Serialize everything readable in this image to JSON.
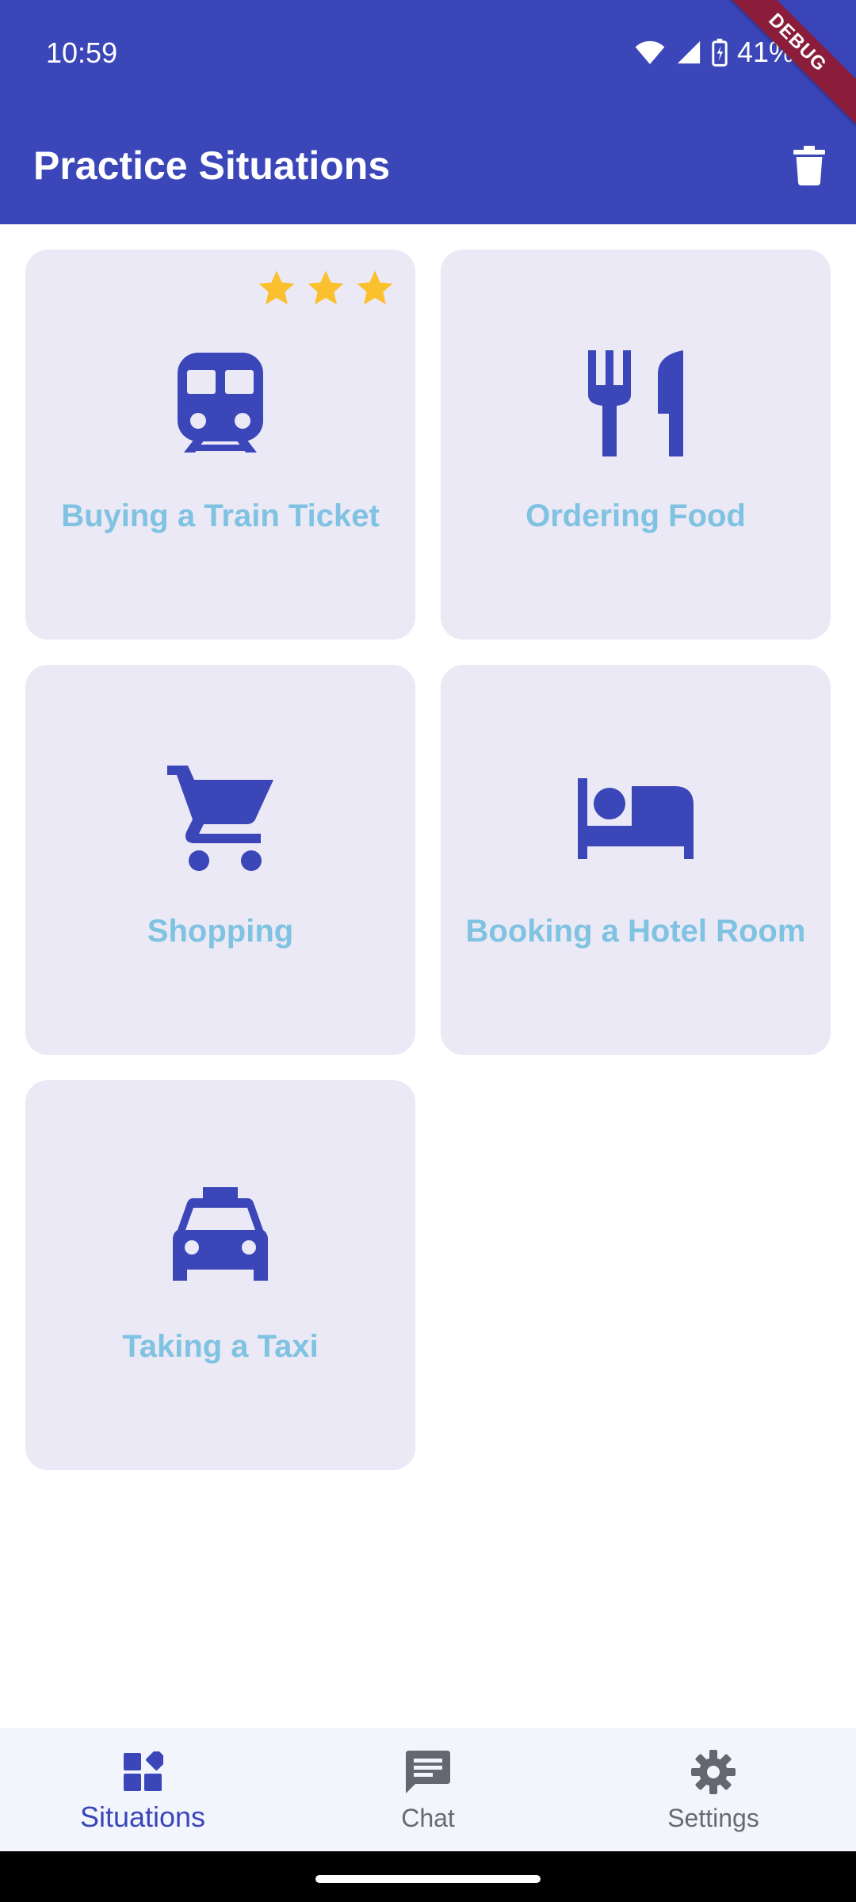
{
  "status_bar": {
    "time": "10:59",
    "battery": "41%"
  },
  "debug_banner": "DEBUG",
  "app_bar": {
    "title": "Practice Situations",
    "action_icon": "trash-icon"
  },
  "colors": {
    "primary": "#3b46b9",
    "card_background": "#eae9f5",
    "card_label": "#7fc2e2",
    "star": "#fbc02d",
    "nav_background": "#f3f5fd"
  },
  "situations": [
    {
      "label": "Buying a Train Ticket",
      "icon": "train-icon",
      "stars": 3
    },
    {
      "label": "Ordering Food",
      "icon": "restaurant-icon",
      "stars": 0
    },
    {
      "label": "Shopping",
      "icon": "shopping-cart-icon",
      "stars": 0
    },
    {
      "label": "Booking a Hotel Room",
      "icon": "bed-icon",
      "stars": 0
    },
    {
      "label": "Taking a Taxi",
      "icon": "taxi-icon",
      "stars": 0
    }
  ],
  "bottom_nav": {
    "items": [
      {
        "label": "Situations",
        "icon": "widgets-icon",
        "active": true
      },
      {
        "label": "Chat",
        "icon": "chat-icon",
        "active": false
      },
      {
        "label": "Settings",
        "icon": "settings-icon",
        "active": false
      }
    ]
  }
}
